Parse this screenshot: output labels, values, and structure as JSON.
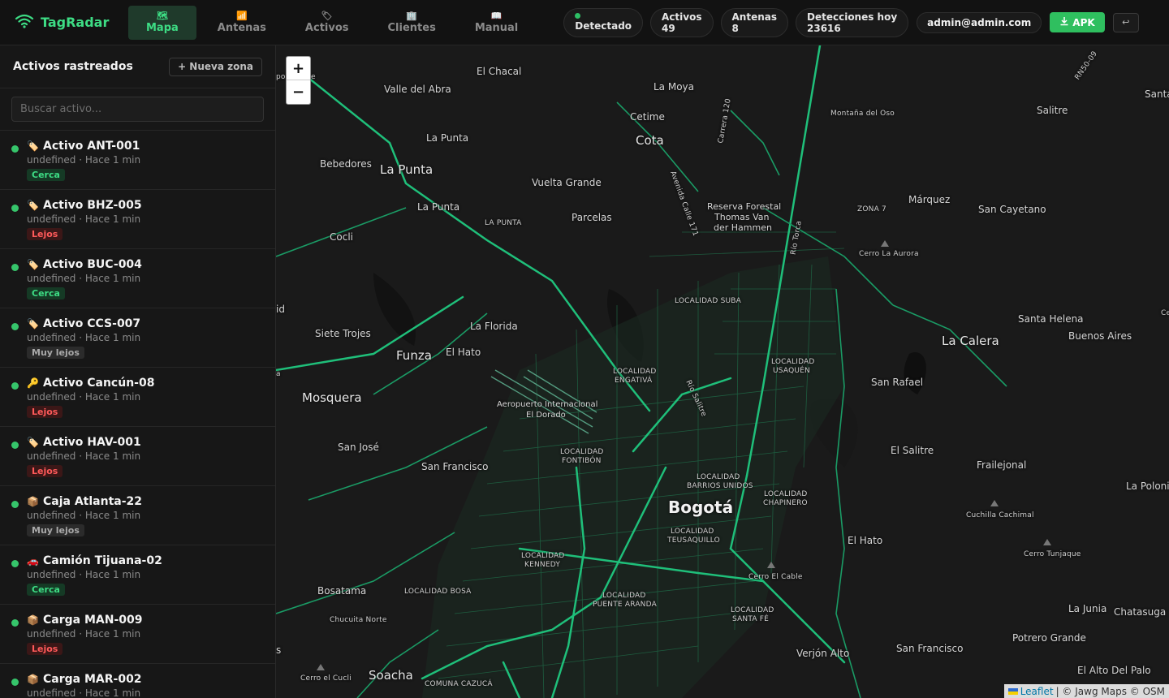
{
  "app": {
    "title": "TagRadar"
  },
  "nav": [
    {
      "label": "Mapa",
      "icon": "map-icon",
      "glyph": "🗺",
      "active": true
    },
    {
      "label": "Antenas",
      "icon": "antenna-icon",
      "glyph": "📶",
      "active": false
    },
    {
      "label": "Activos",
      "icon": "tag-icon",
      "glyph": "🏷",
      "active": false
    },
    {
      "label": "Clientes",
      "icon": "building-icon",
      "glyph": "🏢",
      "active": false
    },
    {
      "label": "Manual",
      "icon": "book-icon",
      "glyph": "📖",
      "active": false
    }
  ],
  "status": {
    "detected_label": "Detectado",
    "activos_label": "Activos",
    "activos_value": "49",
    "antenas_label": "Antenas",
    "antenas_value": "8",
    "detecciones_label": "Detecciones hoy",
    "detecciones_value": "23616"
  },
  "user": {
    "email": "admin@admin.com"
  },
  "actions": {
    "apk_label": "APK",
    "logout_glyph": "↩"
  },
  "sidebar": {
    "title": "Activos rastreados",
    "new_zone_label": "+ Nueva zona",
    "search_placeholder": "Buscar activo...",
    "items": [
      {
        "emoji": "🏷️",
        "name": "Activo ANT-001",
        "sub": "undefined · Hace 1 min",
        "badge": "Cerca",
        "badge_type": "cerca"
      },
      {
        "emoji": "🏷️",
        "name": "Activo BHZ-005",
        "sub": "undefined · Hace 1 min",
        "badge": "Lejos",
        "badge_type": "lejos"
      },
      {
        "emoji": "🏷️",
        "name": "Activo BUC-004",
        "sub": "undefined · Hace 1 min",
        "badge": "Cerca",
        "badge_type": "cerca"
      },
      {
        "emoji": "🏷️",
        "name": "Activo CCS-007",
        "sub": "undefined · Hace 1 min",
        "badge": "Muy lejos",
        "badge_type": "muylejos"
      },
      {
        "emoji": "🔑",
        "name": "Activo Cancún-08",
        "sub": "undefined · Hace 1 min",
        "badge": "Lejos",
        "badge_type": "lejos"
      },
      {
        "emoji": "🏷️",
        "name": "Activo HAV-001",
        "sub": "undefined · Hace 1 min",
        "badge": "Lejos",
        "badge_type": "lejos"
      },
      {
        "emoji": "📦",
        "name": "Caja Atlanta-22",
        "sub": "undefined · Hace 1 min",
        "badge": "Muy lejos",
        "badge_type": "muylejos"
      },
      {
        "emoji": "🚗",
        "name": "Camión Tijuana-02",
        "sub": "undefined · Hace 1 min",
        "badge": "Cerca",
        "badge_type": "cerca"
      },
      {
        "emoji": "📦",
        "name": "Carga MAN-009",
        "sub": "undefined · Hace 1 min",
        "badge": "Lejos",
        "badge_type": "lejos"
      },
      {
        "emoji": "📦",
        "name": "Carga MAR-002",
        "sub": "undefined · Hace 1 min",
        "badge": "",
        "badge_type": ""
      }
    ]
  },
  "map": {
    "zoom_in": "+",
    "zoom_out": "−",
    "attribution_leaflet": "Leaflet",
    "attribution_rest": "| © Jawg Maps © OSM",
    "labels": [
      "El Chacal",
      "Valle del Abra",
      "La Moya",
      "Cetime",
      "Cota",
      "Carrera 120",
      "Montaña del Oso",
      "Salitre",
      "RN50-09",
      "Santa",
      "La Punta",
      "Bebedores",
      "La Punta",
      "Vuelta Grande",
      "Reserva Forestal",
      "Thomas Van",
      "der Hammen",
      "Avenida Calle 171",
      "Márquez",
      "San Cayetano",
      "ZONA 7",
      "Río Torca",
      "La Punta",
      "LA PUNTA",
      "Parcelas",
      "Cocli",
      "Cerro La Aurora",
      "LOCALIDAD SUBA",
      "Santa Helena",
      "Buenos Aires",
      "La Calera",
      "Siete Trojes",
      "La Florida",
      "Funza",
      "El Hato",
      "LOCALIDAD",
      "USAQUÉN",
      "LOCALIDAD",
      "ENGATIVÁ",
      "San Rafael",
      "Río Salitre",
      "Mosquera",
      "Aeropuerto Internacional",
      "El Dorado",
      "San José",
      "LOCALIDAD",
      "FONTIBÓN",
      "El Salitre",
      "San Francisco",
      "Frailejonal",
      "LOCALIDAD",
      "BARRIOS UNIDOS",
      "LOCALIDAD",
      "CHAPINERO",
      "La Polonia",
      "Bogotá",
      "Cuchilla Cachimal",
      "LOCALIDAD",
      "TEUSAQUILLO",
      "El Hato",
      "LOCALIDAD",
      "KENNEDY",
      "Cerro Tunjaque",
      "Cerro El Cable",
      "Bosatama",
      "LOCALIDAD BOSA",
      "LOCALIDAD",
      "PUENTE ARANDA",
      "La Junia",
      "Chatasuga",
      "LOCALIDAD",
      "SANTA FÉ",
      "Chucuita Norte",
      "Potrero Grande",
      "Verjón Alto",
      "San Francisco",
      "El Alto Del Palo",
      "Cerro el Cucli",
      "Soacha",
      "COMUNA CAZUCÁ",
      "po",
      "e",
      "id",
      "a",
      "s",
      "Ce"
    ]
  }
}
